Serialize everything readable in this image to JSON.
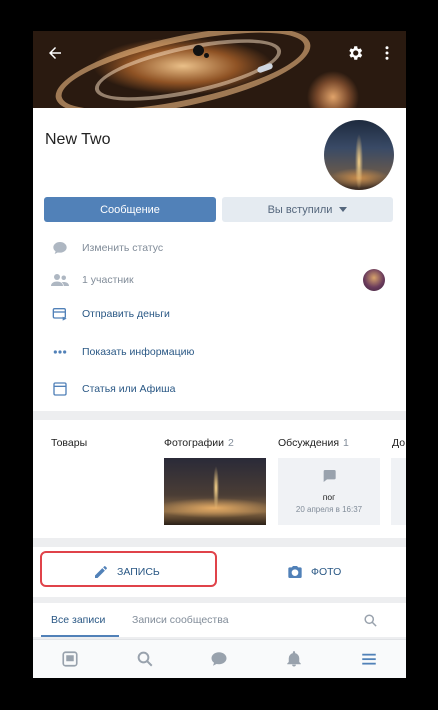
{
  "header": {
    "back_icon": "arrow-left-icon",
    "settings_icon": "gear-icon",
    "more_icon": "more-vertical-icon"
  },
  "profile": {
    "name": "New Two",
    "message_button": "Сообщение",
    "joined_button": "Вы вступили",
    "change_status": "Изменить статус",
    "members": "1 участник",
    "send_money": "Отправить деньги",
    "show_info": "Показать информацию",
    "article": "Статья или Афиша"
  },
  "sections": {
    "goods": "Товары",
    "photos": "Фотографии",
    "photos_count": "2",
    "discussions": "Обсуждения",
    "discussions_count": "1",
    "more_truncated": "До",
    "discussion_topic": "пог",
    "discussion_date": "20 апреля в 16:37"
  },
  "actions": {
    "post": "ЗАПИСЬ",
    "photo": "ФОТО"
  },
  "feed_tabs": {
    "all_posts": "Все записи",
    "community_posts": "Записи сообщества"
  },
  "colors": {
    "accent": "#5181b8",
    "link": "#2a5885",
    "muted": "#818c99",
    "highlight": "#e0434a"
  }
}
